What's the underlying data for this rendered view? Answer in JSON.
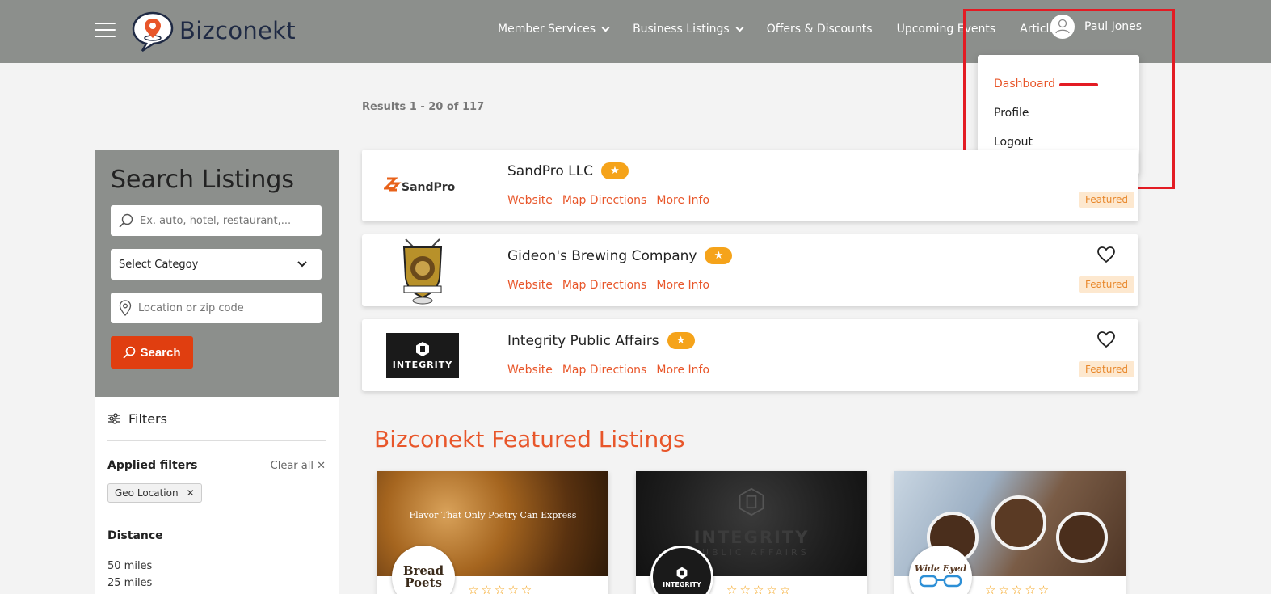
{
  "brand": {
    "name": "Bizconekt",
    "accent": "#e8562a",
    "header_bg": "#8c8f8c"
  },
  "nav": {
    "items": [
      {
        "label": "Member Services",
        "has_dropdown": true
      },
      {
        "label": "Business Listings",
        "has_dropdown": true
      },
      {
        "label": "Offers & Discounts",
        "has_dropdown": false
      },
      {
        "label": "Upcoming Events",
        "has_dropdown": false
      },
      {
        "label": "Articles",
        "has_dropdown": false
      }
    ],
    "user_name": "Paul Jones"
  },
  "user_menu": {
    "items": [
      {
        "label": "Dashboard",
        "active": true
      },
      {
        "label": "Profile",
        "active": false
      },
      {
        "label": "Logout",
        "active": false
      }
    ]
  },
  "results": {
    "text": "Results 1 - 20 of 117"
  },
  "search": {
    "title": "Search Listings",
    "keyword_placeholder": "Ex. auto, hotel, restaurant,...",
    "category_selected": "Select Categoy",
    "location_placeholder": "Location or zip code",
    "button_label": "Search"
  },
  "filters": {
    "title": "Filters",
    "applied_label": "Applied filters",
    "clear_all": "Clear all ✕",
    "chips": [
      "Geo Location"
    ],
    "distance_title": "Distance",
    "distance_options": [
      "50 miles",
      "25 miles"
    ]
  },
  "listings": [
    {
      "name": "SandPro LLC",
      "links": [
        "Website",
        "Map Directions",
        "More Info"
      ],
      "tag": "Featured",
      "logo": "SandPro"
    },
    {
      "name": "Gideon's Brewing Company",
      "links": [
        "Website",
        "Map Directions",
        "More Info"
      ],
      "tag": "Featured",
      "logo": "gideons-lion-crest"
    },
    {
      "name": "Integrity Public Affairs",
      "links": [
        "Website",
        "Map Directions",
        "More Info"
      ],
      "tag": "Featured",
      "logo": "INTEGRITY"
    }
  ],
  "featured": {
    "title": "Bizconekt Featured Listings",
    "cards": [
      {
        "image_caption": "Flavor That Only Poetry Can Express",
        "logo_text_1": "Bread",
        "logo_text_2": "Poets",
        "stars": "☆☆☆☆☆"
      },
      {
        "image_caption": "INTEGRITY",
        "image_sub": "PUBLIC AFFAIRS",
        "logo_text_1": "INTEGRITY",
        "stars": "☆☆☆☆☆"
      },
      {
        "image_caption": "",
        "logo_text_1": "Wide Eyed",
        "stars": "☆☆☆☆☆"
      }
    ]
  }
}
